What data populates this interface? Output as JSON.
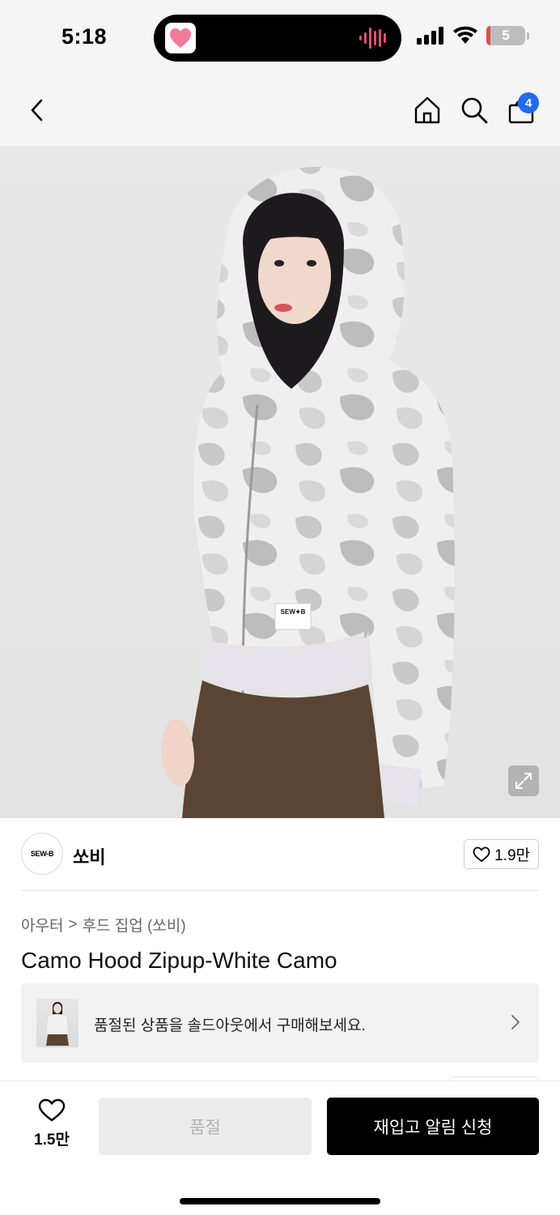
{
  "status_bar": {
    "time": "5:18",
    "battery_level": "5"
  },
  "nav": {
    "cart_count": "4",
    "icons": [
      "chevron-left-icon",
      "home-icon",
      "search-icon",
      "shopping-bag-icon"
    ]
  },
  "product_image": {
    "logo_tag": "SEW✦B"
  },
  "brand": {
    "logo_text": "SEW-B",
    "name": "쏘비",
    "like_count": "1.9만"
  },
  "breadcrumb": {
    "category": "아우터",
    "separator": ">",
    "subcategory": "후드 집업 (쏘비)"
  },
  "product": {
    "title": "Camo Hood Zipup-White Camo"
  },
  "soldout_banner": {
    "text": "품절된 상품을 솔드아웃에서 구매해보세요."
  },
  "bottom_bar": {
    "like_count": "1.5만",
    "soldout_label": "품절",
    "restock_label": "재입고 알림 신청"
  },
  "colors": {
    "badge": "#1f6cf2",
    "primary_button": "#000000",
    "disabled_button": "#ececec"
  }
}
